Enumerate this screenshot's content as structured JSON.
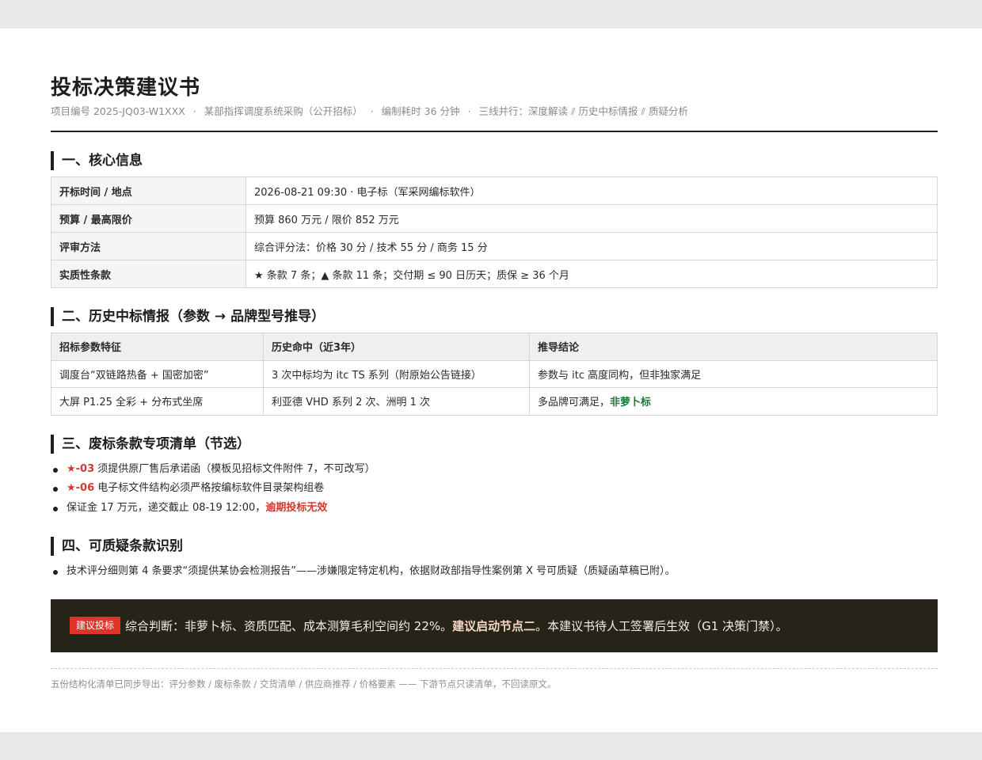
{
  "doc": {
    "title": "投标决策建议书",
    "meta": {
      "project": "项目编号 2025-JQ03-W1XXX",
      "name": "某部指挥调度系统采购（公开招标）",
      "duration": "编制耗时 36 分钟",
      "lines": "三线并行：深度解读 ⫽ 历史中标情报 ⫽ 质疑分析",
      "separator": "·"
    }
  },
  "section1": {
    "title": "一、核心信息",
    "rows": [
      {
        "label": "开标时间 / 地点",
        "value": "2026-08-21 09:30 · 电子标（军采网编标软件）"
      },
      {
        "label": "预算 / 最高限价",
        "value": "预算 860 万元 / 限价 852 万元"
      },
      {
        "label": "评审方法",
        "value": "综合评分法：价格 30 分 / 技术 55 分 / 商务 15 分"
      },
      {
        "label": "实质性条款",
        "value": "★ 条款 7 条；▲ 条款 11 条；交付期 ≤ 90 日历天；质保 ≥ 36 个月"
      }
    ]
  },
  "section2": {
    "title": "二、历史中标情报（参数 → 品牌型号推导）",
    "headers": [
      "招标参数特征",
      "历史命中（近3年）",
      "推导结论"
    ],
    "rows": [
      {
        "feature": "调度台“双链路热备 + 国密加密”",
        "hits": "3 次中标均为 itc TS 系列（附原始公告链接）",
        "conclusion": "参数与 itc 高度同构，但非独家满足",
        "conclusion_hl": ""
      },
      {
        "feature": "大屏 P1.25 全彩 + 分布式坐席",
        "hits": "利亚德 VHD 系列 2 次、洲明 1 次",
        "conclusion": "多品牌可满足，",
        "conclusion_hl": "非萝卜标"
      }
    ]
  },
  "section3": {
    "title": "三、废标条款专项清单（节选）",
    "items": [
      {
        "tag": "★-03",
        "text": " 须提供原厂售后承诺函（模板见招标文件附件 7，不可改写）",
        "tail": ""
      },
      {
        "tag": "★-06",
        "text": " 电子标文件结构必须严格按编标软件目录架构组卷",
        "tail": ""
      },
      {
        "tag": "",
        "text": "保证金 17 万元，递交截止 08-19 12:00，",
        "tail": "逾期投标无效"
      }
    ]
  },
  "section4": {
    "title": "四、可质疑条款识别",
    "items": [
      {
        "text": "技术评分细则第 4 条要求“须提供某协会检测报告”——涉嫌限定特定机构，依据财政部指导性案例第 X 号可质疑（质疑函草稿已附）。"
      }
    ]
  },
  "verdict": {
    "badge": "建议投标",
    "text": "综合判断：非萝卜标、资质匹配、成本测算毛利空间约 22%。",
    "highlight": "建议启动节点二",
    "tail": "。本建议书待人工签署后生效（G1 决策门禁）。"
  },
  "footer": {
    "text": "五份结构化清单已同步导出：评分参数 / 废标条款 / 交货清单 / 供应商推荐 / 价格要素 —— 下游节点只读清单，不回读原文。"
  },
  "colors": {
    "accent_red": "#d23a2f",
    "accent_green": "#1b7a3a",
    "verdict_bg": "#262418"
  }
}
